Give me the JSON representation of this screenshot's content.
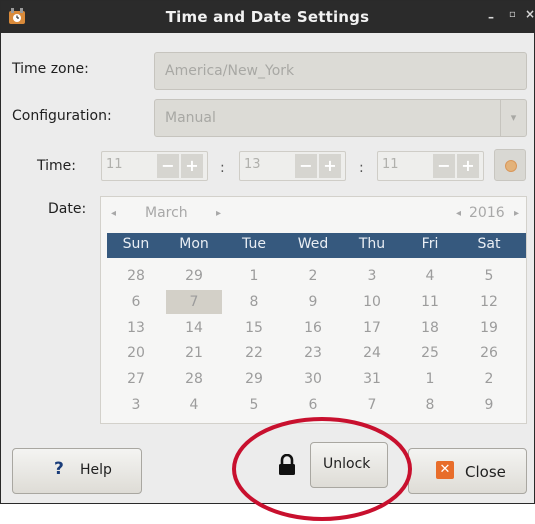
{
  "window": {
    "title": "Time and Date Settings"
  },
  "timezone": {
    "label": "Time zone:",
    "value": "America/New_York"
  },
  "configuration": {
    "label": "Configuration:",
    "value": "Manual"
  },
  "time": {
    "label": "Time:",
    "hour": "11",
    "minute": "13",
    "second": "11",
    "separator": ":",
    "minus": "−",
    "plus": "+"
  },
  "date": {
    "label": "Date:",
    "month": "March",
    "year": "2016",
    "prev_month": "◂",
    "next_month": "▸",
    "prev_year": "◂",
    "next_year": "▸",
    "weekdays": [
      "Sun",
      "Mon",
      "Tue",
      "Wed",
      "Thu",
      "Fri",
      "Sat"
    ],
    "weeks": [
      [
        "28",
        "29",
        "1",
        "2",
        "3",
        "4",
        "5"
      ],
      [
        "6",
        "7",
        "8",
        "9",
        "10",
        "11",
        "12"
      ],
      [
        "13",
        "14",
        "15",
        "16",
        "17",
        "18",
        "19"
      ],
      [
        "20",
        "21",
        "22",
        "23",
        "24",
        "25",
        "26"
      ],
      [
        "27",
        "28",
        "29",
        "30",
        "31",
        "1",
        "2"
      ],
      [
        "3",
        "4",
        "5",
        "6",
        "7",
        "8",
        "9"
      ]
    ],
    "selected_day": "7"
  },
  "buttons": {
    "help_icon": "?",
    "help": "Help",
    "unlock": "Unlock",
    "close_icon": "✕",
    "close": "Close"
  },
  "titlebar_controls": {
    "minimize": "–",
    "maximize": "▫",
    "close": "×"
  },
  "colors": {
    "title_bar": "#2b2b2b",
    "calendar_header": "#36597e",
    "annotation_ring": "#c8102e",
    "close_icon_bg": "#e86d2a"
  }
}
